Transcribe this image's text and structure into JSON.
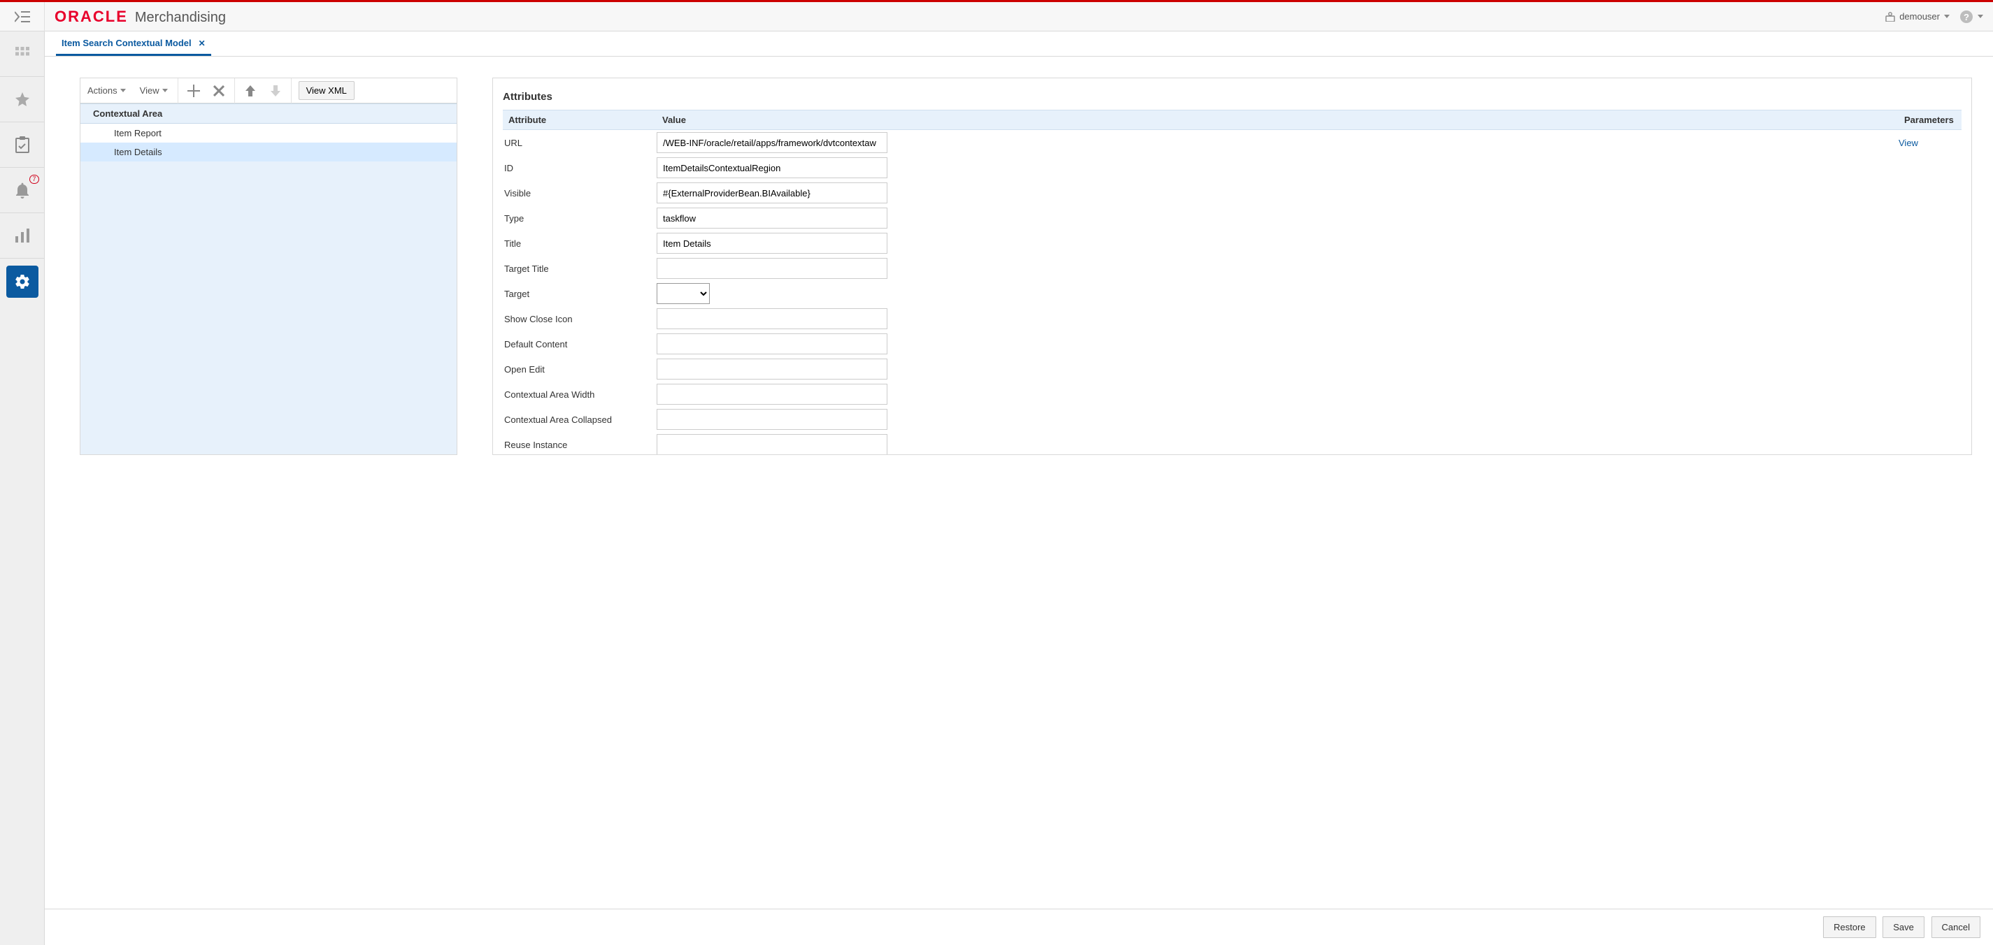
{
  "header": {
    "brand_logo": "ORACLE",
    "brand_sub": "Merchandising",
    "username": "demouser"
  },
  "sidebar": {
    "notification_badge": "7"
  },
  "tab": {
    "label": "Item Search Contextual Model"
  },
  "toolbar": {
    "actions": "Actions",
    "view": "View",
    "view_xml": "View XML"
  },
  "tree": {
    "header": "Contextual Area",
    "rows": [
      "Item Report",
      "Item Details"
    ],
    "selected_index": 1
  },
  "attributes": {
    "title": "Attributes",
    "headers": {
      "attr": "Attribute",
      "value": "Value",
      "params": "Parameters"
    },
    "view_link": "View",
    "rows": [
      {
        "label": "URL",
        "value": "/WEB-INF/oracle/retail/apps/framework/dvtcontextaw",
        "has_view": true
      },
      {
        "label": "ID",
        "value": "ItemDetailsContextualRegion"
      },
      {
        "label": "Visible",
        "value": "#{ExternalProviderBean.BIAvailable}"
      },
      {
        "label": "Type",
        "value": "taskflow"
      },
      {
        "label": "Title",
        "value": "Item Details"
      },
      {
        "label": "Target Title",
        "value": ""
      },
      {
        "label": "Target",
        "type": "select",
        "value": ""
      },
      {
        "label": "Show Close Icon",
        "value": ""
      },
      {
        "label": "Default Content",
        "value": ""
      },
      {
        "label": "Open Edit",
        "value": ""
      },
      {
        "label": "Contextual Area Width",
        "value": ""
      },
      {
        "label": "Contextual Area Collapsed",
        "value": ""
      },
      {
        "label": "Reuse Instance",
        "value": ""
      }
    ]
  },
  "footer": {
    "restore": "Restore",
    "save": "Save",
    "cancel": "Cancel"
  }
}
